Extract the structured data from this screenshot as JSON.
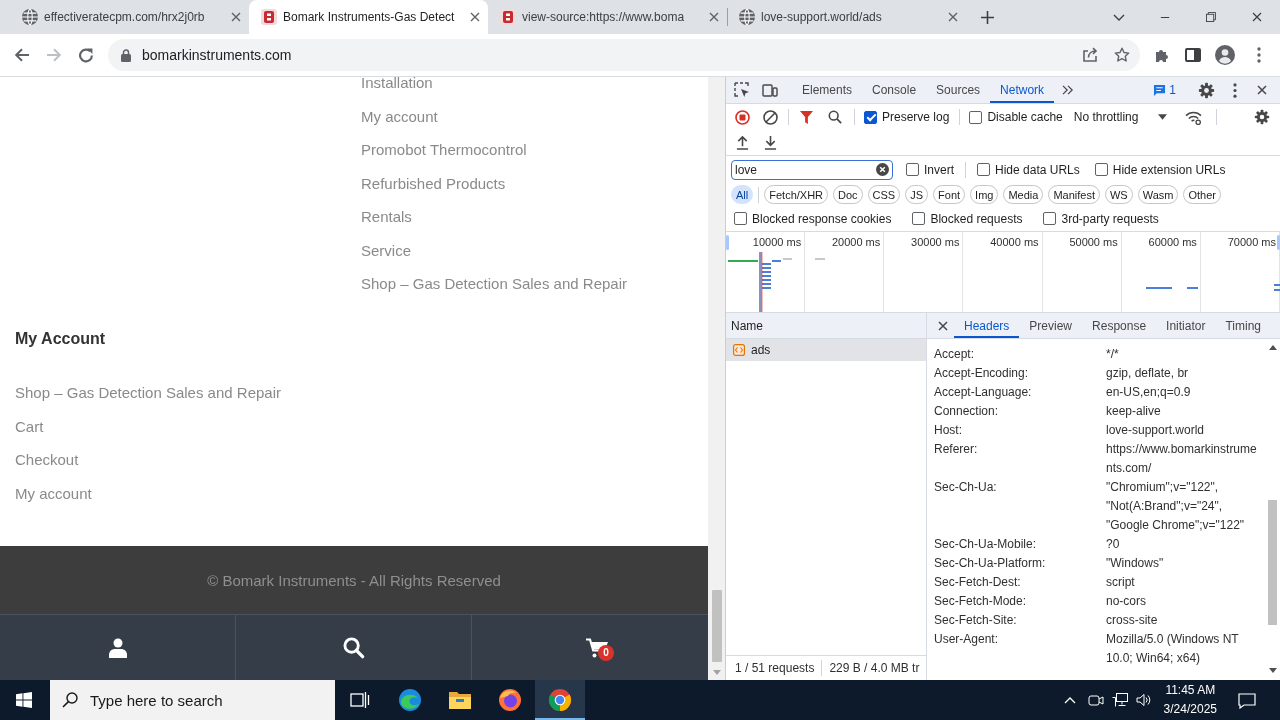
{
  "browser": {
    "tabs": [
      {
        "title": "effectiveratecpm.com/hrx2j0rb",
        "kind": "globe",
        "selected": false
      },
      {
        "title": "Bomark Instruments-Gas Detect",
        "kind": "site",
        "selected": true
      },
      {
        "title": "view-source:https://www.boma",
        "kind": "site",
        "selected": false
      },
      {
        "title": "love-support.world/ads",
        "kind": "globe",
        "selected": false
      }
    ],
    "address": "bomarkinstruments.com"
  },
  "page": {
    "links": [
      "Installation",
      "My account",
      "Promobot Thermocontrol",
      "Refurbished Products",
      "Rentals",
      "Service",
      "Shop – Gas Detection Sales and Repair"
    ],
    "my_account": {
      "heading": "My Account",
      "links": [
        "Shop – Gas Detection Sales and Repair",
        "Cart",
        "Checkout",
        "My account"
      ]
    },
    "copyright": "© Bomark Instruments - All Rights Reserved",
    "cart_count": "0"
  },
  "devtools": {
    "panels": [
      {
        "label": "Elements",
        "selected": false
      },
      {
        "label": "Console",
        "selected": false
      },
      {
        "label": "Sources",
        "selected": false
      },
      {
        "label": "Network",
        "selected": true
      }
    ],
    "issues_count": "1",
    "toolbar_options": [
      {
        "label": "Preserve log",
        "checked": true
      },
      {
        "label": "Disable cache",
        "checked": false
      }
    ],
    "throttling": "No throttling",
    "filter": {
      "value": "love"
    },
    "filter_options": [
      {
        "label": "Invert",
        "checked": false
      },
      {
        "label": "Hide data URLs",
        "checked": false
      },
      {
        "label": "Hide extension URLs",
        "checked": false
      }
    ],
    "types": [
      {
        "label": "All",
        "selected": true
      },
      {
        "label": "Fetch/XHR",
        "selected": false
      },
      {
        "label": "Doc",
        "selected": false
      },
      {
        "label": "CSS",
        "selected": false
      },
      {
        "label": "JS",
        "selected": false
      },
      {
        "label": "Font",
        "selected": false
      },
      {
        "label": "Img",
        "selected": false
      },
      {
        "label": "Media",
        "selected": false
      },
      {
        "label": "Manifest",
        "selected": false
      },
      {
        "label": "WS",
        "selected": false
      },
      {
        "label": "Wasm",
        "selected": false
      },
      {
        "label": "Other",
        "selected": false
      }
    ],
    "more_filters": [
      {
        "label": "Blocked response cookies",
        "checked": false
      },
      {
        "label": "Blocked requests",
        "checked": false
      },
      {
        "label": "3rd-party requests",
        "checked": false
      }
    ],
    "overview_ticks": [
      "10000 ms",
      "20000 ms",
      "30000 ms",
      "40000 ms",
      "50000 ms",
      "60000 ms",
      "70000 ms"
    ],
    "requests": {
      "column": "Name",
      "rows": [
        {
          "name": "ads",
          "selected": true
        }
      ]
    },
    "summary": [
      "1 / 51 requests",
      "229 B / 4.0 MB tr"
    ],
    "detail_tabs": [
      {
        "label": "Headers",
        "selected": true
      },
      {
        "label": "Preview",
        "selected": false
      },
      {
        "label": "Response",
        "selected": false
      },
      {
        "label": "Initiator",
        "selected": false
      },
      {
        "label": "Timing",
        "selected": false
      }
    ],
    "headers": [
      {
        "name": "Accept:",
        "value": "*/*"
      },
      {
        "name": "Accept-Encoding:",
        "value": "gzip, deflate, br"
      },
      {
        "name": "Accept-Language:",
        "value": "en-US,en;q=0.9"
      },
      {
        "name": "Connection:",
        "value": "keep-alive"
      },
      {
        "name": "Host:",
        "value": "love-support.world"
      },
      {
        "name": "Referer:",
        "value": "https://www.bomarkinstruments.com/"
      },
      {
        "name": "Sec-Ch-Ua:",
        "value": "\"Chromium\";v=\"122\", \"Not(A:Brand\";v=\"24\", \"Google Chrome\";v=\"122\""
      },
      {
        "name": "Sec-Ch-Ua-Mobile:",
        "value": "?0"
      },
      {
        "name": "Sec-Ch-Ua-Platform:",
        "value": "\"Windows\""
      },
      {
        "name": "Sec-Fetch-Dest:",
        "value": "script"
      },
      {
        "name": "Sec-Fetch-Mode:",
        "value": "no-cors"
      },
      {
        "name": "Sec-Fetch-Site:",
        "value": "cross-site"
      },
      {
        "name": "User-Agent:",
        "value": "Mozilla/5.0 (Windows NT 10.0; Win64; x64)"
      }
    ]
  },
  "taskbar": {
    "search_placeholder": "Type here to search",
    "apps": [
      {
        "kind": "task-view",
        "selected": false
      },
      {
        "kind": "edge",
        "selected": false
      },
      {
        "kind": "files",
        "selected": false
      },
      {
        "kind": "firefox",
        "selected": false
      },
      {
        "kind": "chrome",
        "selected": true
      }
    ],
    "time": "11:45 AM",
    "date": "3/24/2025"
  }
}
